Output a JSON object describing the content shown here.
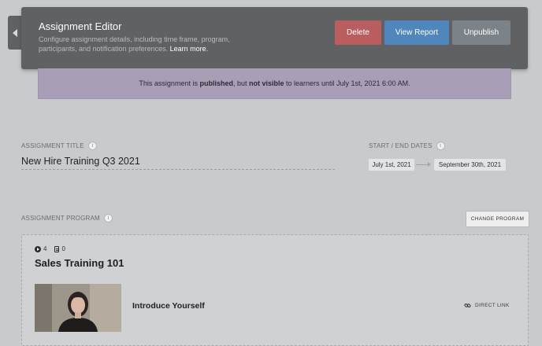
{
  "header": {
    "title": "Assignment Editor",
    "description": "Configure assignment details, including time frame, program, participants, and notification preferences.",
    "learn_more": "Learn more.",
    "buttons": {
      "delete": "Delete",
      "view_report": "View Report",
      "unpublish": "Unpublish"
    }
  },
  "notice": {
    "prefix": "This assignment is ",
    "status": "published",
    "middle": ", but ",
    "visibility": "not visible",
    "suffix": " to learners until July 1st, 2021 6:00 AM."
  },
  "assignment_title": {
    "label": "Assignment Title",
    "value": "New Hire Training Q3 2021"
  },
  "dates": {
    "label": "Start / End Dates",
    "start": "July 1st, 2021",
    "end": "September 30th, 2021"
  },
  "program_section": {
    "label": "Assignment Program",
    "change_button": "CHANGE PROGRAM"
  },
  "program": {
    "video_count": "4",
    "doc_count": "0",
    "name": "Sales Training 101",
    "lesson_title": "Introduce Yourself",
    "direct_link": "DIRECT LINK"
  },
  "icons": {
    "info": "i"
  },
  "colors": {
    "delete": "#b95d5e",
    "view_report": "#4f86bb",
    "unpublish": "#7b8288",
    "notice_bg": "#a89fb6"
  }
}
